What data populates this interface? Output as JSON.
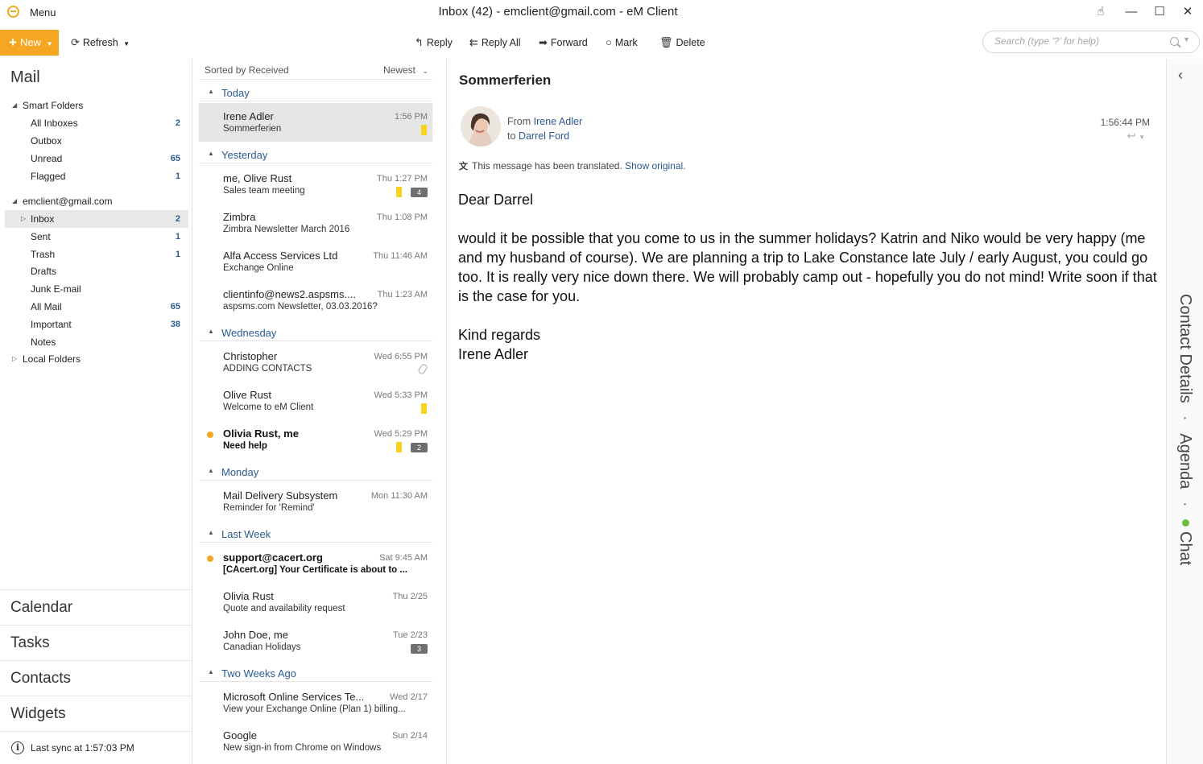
{
  "titlebar": {
    "menu_label": "Menu",
    "window_title": "Inbox (42) - emclient@gmail.com - eM Client"
  },
  "toolbar": {
    "new_label": "New",
    "refresh_label": "Refresh",
    "reply_label": "Reply",
    "reply_all_label": "Reply All",
    "forward_label": "Forward",
    "mark_label": "Mark",
    "delete_label": "Delete",
    "search_placeholder": "Search (type '?' for help)"
  },
  "sidebar": {
    "heading": "Mail",
    "smart_folders": {
      "label": "Smart Folders",
      "items": [
        {
          "label": "All Inboxes",
          "count": "2"
        },
        {
          "label": "Outbox",
          "count": ""
        },
        {
          "label": "Unread",
          "count": "65"
        },
        {
          "label": "Flagged",
          "count": "1"
        }
      ]
    },
    "account": {
      "label": "emclient@gmail.com",
      "items": [
        {
          "label": "Inbox",
          "count": "2",
          "selected": true
        },
        {
          "label": "Sent",
          "count": "1"
        },
        {
          "label": "Trash",
          "count": "1"
        },
        {
          "label": "Drafts",
          "count": ""
        },
        {
          "label": "Junk E-mail",
          "count": ""
        },
        {
          "label": "All Mail",
          "count": "65"
        },
        {
          "label": "Important",
          "count": "38"
        },
        {
          "label": "Notes",
          "count": ""
        }
      ]
    },
    "local_folders_label": "Local Folders",
    "modules": [
      "Calendar",
      "Tasks",
      "Contacts",
      "Widgets"
    ],
    "sync_status": "Last sync at 1:57:03 PM"
  },
  "message_list": {
    "sort_label": "Sorted by Received",
    "sort_order": "Newest",
    "groups": [
      {
        "label": "Today",
        "messages": [
          {
            "sender": "Irene Adler",
            "subject": "Sommerferien",
            "time": "1:56 PM",
            "flag": true,
            "selected": true
          }
        ]
      },
      {
        "label": "Yesterday",
        "messages": [
          {
            "sender": "me, Olive Rust",
            "subject": "Sales team meeting",
            "time": "Thu 1:27 PM",
            "flag": true,
            "badge": "4"
          },
          {
            "sender": "Zimbra",
            "subject": "Zimbra Newsletter March 2016",
            "time": "Thu 1:08 PM"
          },
          {
            "sender": "Alfa Access Services Ltd",
            "subject": "Exchange Online",
            "time": "Thu 11:46 AM"
          },
          {
            "sender": "clientinfo@news2.aspsms....",
            "subject": "aspsms.com Newsletter, 03.03.2016?",
            "time": "Thu 1:23 AM"
          }
        ]
      },
      {
        "label": "Wednesday",
        "messages": [
          {
            "sender": "Christopher",
            "subject": "ADDING CONTACTS",
            "time": "Wed 6:55 PM",
            "attachment": true
          },
          {
            "sender": "Olive Rust",
            "subject": "Welcome to eM Client",
            "time": "Wed 5:33 PM",
            "flag": true
          },
          {
            "sender": "Olivia Rust, me",
            "subject": "Need help",
            "time": "Wed 5:29 PM",
            "flag": true,
            "badge": "2",
            "unread": true
          }
        ]
      },
      {
        "label": "Monday",
        "messages": [
          {
            "sender": "Mail Delivery Subsystem",
            "subject": "Reminder for 'Remind'",
            "time": "Mon 11:30 AM"
          }
        ]
      },
      {
        "label": "Last Week",
        "messages": [
          {
            "sender": "support@cacert.org",
            "subject": "[CAcert.org] Your Certificate is about to ...",
            "time": "Sat 9:45 AM",
            "unread": true
          },
          {
            "sender": "Olivia Rust",
            "subject": "Quote and availability request",
            "time": "Thu 2/25"
          },
          {
            "sender": "John Doe, me",
            "subject": "Canadian Holidays",
            "time": "Tue 2/23",
            "badge": "3"
          }
        ]
      },
      {
        "label": "Two Weeks Ago",
        "messages": [
          {
            "sender": "Microsoft Online Services Te...",
            "subject": "View your Exchange Online (Plan 1) billing...",
            "time": "Wed 2/17"
          },
          {
            "sender": "Google",
            "subject": "New sign-in from Chrome on Windows",
            "time": "Sun 2/14"
          }
        ]
      }
    ]
  },
  "reader": {
    "subject": "Sommerferien",
    "from_prefix": "From",
    "from_name": "Irene Adler",
    "to_prefix": "to",
    "to_name": "Darrel Ford",
    "received_time": "1:56:44 PM",
    "translated_notice": "This message has been translated.",
    "show_original_link": "Show original.",
    "body": [
      "Dear Darrel",
      "would it be possible that you come to us in the summer holidays? Katrin and Niko would be very happy (me and my husband of course). We are planning a trip to Lake Constance late July / early August, you could go too. It is really very nice down there. We will probably camp out - hopefully you do not mind! Write soon if that is the case for you.",
      "Kind regards\nIrene Adler"
    ]
  },
  "rail": {
    "contact_details": "Contact Details",
    "agenda": "Agenda",
    "chat": "Chat",
    "separator": "·"
  },
  "colors": {
    "accent": "#f5a623",
    "link": "#2a5b8f",
    "flag": "#f7d51d",
    "online": "#6cbf3f"
  }
}
